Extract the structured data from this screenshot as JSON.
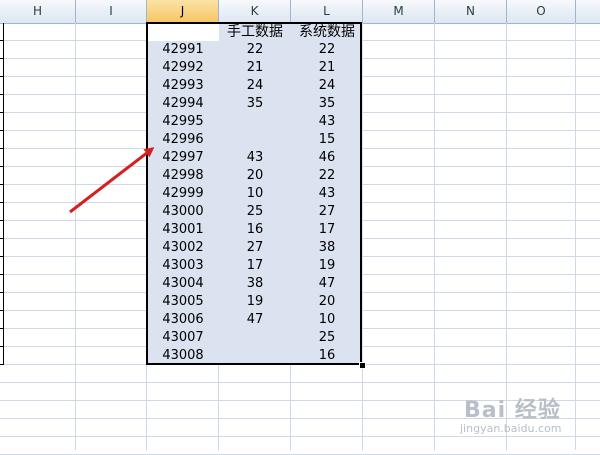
{
  "columns": [
    {
      "letter": "H",
      "selected": false
    },
    {
      "letter": "I",
      "selected": false
    },
    {
      "letter": "J",
      "selected": true
    },
    {
      "letter": "K",
      "selected": false
    },
    {
      "letter": "L",
      "selected": false
    },
    {
      "letter": "M",
      "selected": false
    },
    {
      "letter": "N",
      "selected": false
    },
    {
      "letter": "O",
      "selected": false
    }
  ],
  "table": {
    "header": {
      "J": "",
      "K": "手工数据",
      "L": "系统数据"
    },
    "rows": [
      {
        "J": "42991",
        "K": "22",
        "L": "22"
      },
      {
        "J": "42992",
        "K": "21",
        "L": "21"
      },
      {
        "J": "42993",
        "K": "24",
        "L": "24"
      },
      {
        "J": "42994",
        "K": "35",
        "L": "35"
      },
      {
        "J": "42995",
        "K": "",
        "L": "43"
      },
      {
        "J": "42996",
        "K": "",
        "L": "15"
      },
      {
        "J": "42997",
        "K": "43",
        "L": "46"
      },
      {
        "J": "42998",
        "K": "20",
        "L": "22"
      },
      {
        "J": "42999",
        "K": "10",
        "L": "43"
      },
      {
        "J": "43000",
        "K": "25",
        "L": "27"
      },
      {
        "J": "43001",
        "K": "16",
        "L": "17"
      },
      {
        "J": "43002",
        "K": "27",
        "L": "38"
      },
      {
        "J": "43003",
        "K": "17",
        "L": "19"
      },
      {
        "J": "43004",
        "K": "38",
        "L": "47"
      },
      {
        "J": "43005",
        "K": "19",
        "L": "20"
      },
      {
        "J": "43006",
        "K": "47",
        "L": "10"
      },
      {
        "J": "43007",
        "K": "",
        "L": "25"
      },
      {
        "J": "43008",
        "K": "",
        "L": "16"
      }
    ]
  },
  "annotation": {
    "arrow_color": "#d42020",
    "arrow_icon": "red-arrow-icon"
  },
  "watermark": {
    "brand": "Bai 经验",
    "url": "jingyan.baidu.com"
  },
  "colors": {
    "selection": "#dce3f0",
    "header_selected": "#f6c55f",
    "gridline": "#d0d7e5"
  }
}
